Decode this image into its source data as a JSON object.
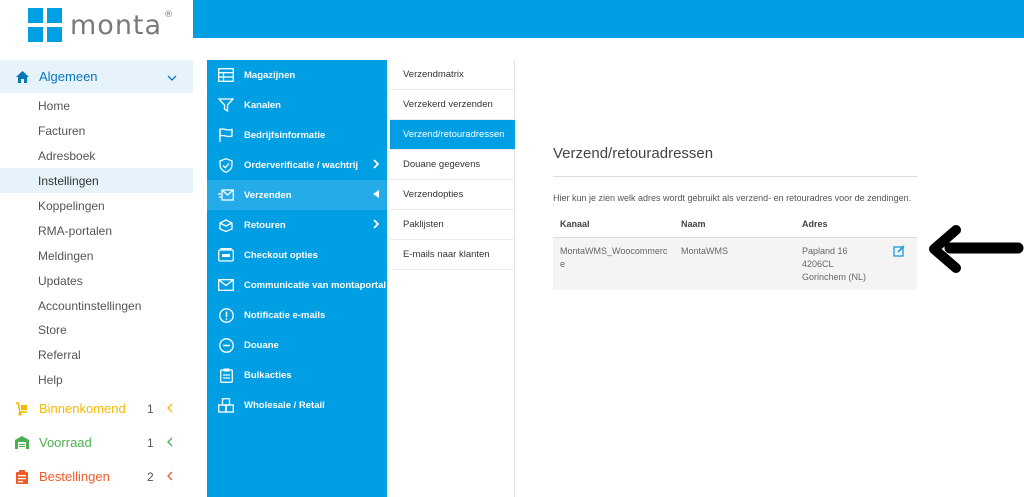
{
  "brand": {
    "logo_text": "monta",
    "registered": "®",
    "color": "#009fe3"
  },
  "sidebar": {
    "section_general": {
      "label": "Algemeen",
      "icon": "home-icon",
      "color": "#0a76b8"
    },
    "items": [
      {
        "label": "Home",
        "active": false
      },
      {
        "label": "Facturen",
        "active": false
      },
      {
        "label": "Adresboek",
        "active": false
      },
      {
        "label": "Instellingen",
        "active": true
      },
      {
        "label": "Koppelingen",
        "active": false
      },
      {
        "label": "RMA-portalen",
        "active": false
      },
      {
        "label": "Meldingen",
        "active": false
      },
      {
        "label": "Updates",
        "active": false
      },
      {
        "label": "Accountinstellingen",
        "active": false
      },
      {
        "label": "Store",
        "active": false
      },
      {
        "label": "Referral",
        "active": false
      },
      {
        "label": "Help",
        "active": false
      }
    ],
    "sections": [
      {
        "label": "Binnenkomend",
        "count": "1",
        "color": "#f5b800",
        "icon": "dolly-icon"
      },
      {
        "label": "Voorraad",
        "count": "1",
        "color": "#4caf50",
        "icon": "warehouse-icon"
      },
      {
        "label": "Bestellingen",
        "count": "2",
        "color": "#f05a28",
        "icon": "clipboard-icon"
      }
    ]
  },
  "menu": {
    "items": [
      {
        "label": "Magazijnen",
        "icon": "table-icon"
      },
      {
        "label": "Kanalen",
        "icon": "funnel-icon"
      },
      {
        "label": "Bedrijfsinformatie",
        "icon": "flag-icon"
      },
      {
        "label": "Orderverificatie / wachtrij",
        "icon": "shield-check-icon",
        "arrow": "right"
      },
      {
        "label": "Verzenden",
        "icon": "envelope-send-icon",
        "arrow": "left",
        "active": true
      },
      {
        "label": "Retouren",
        "icon": "box-return-icon",
        "arrow": "right"
      },
      {
        "label": "Checkout opties",
        "icon": "checkout-icon"
      },
      {
        "label": "Communicatie van montaportal",
        "icon": "mail-icon"
      },
      {
        "label": "Notificatie e-mails",
        "icon": "info-circle-icon"
      },
      {
        "label": "Douane",
        "icon": "minus-circle-icon"
      },
      {
        "label": "Bulkacties",
        "icon": "clipboard-list-icon"
      },
      {
        "label": "Wholesale / Retail",
        "icon": "boxes-icon"
      }
    ]
  },
  "submenu": {
    "items": [
      {
        "label": "Verzendmatrix",
        "active": false
      },
      {
        "label": "Verzekerd verzenden",
        "active": false
      },
      {
        "label": "Verzend/retouradressen",
        "active": true
      },
      {
        "label": "Douane gegevens",
        "active": false
      },
      {
        "label": "Verzendopties",
        "active": false
      },
      {
        "label": "Paklijsten",
        "active": false
      },
      {
        "label": "E-mails naar klanten",
        "active": false
      }
    ]
  },
  "content": {
    "title": "Verzend/retouradressen",
    "description": "Hier kun je zien welk adres wordt gebruikt als verzend- en retouradres voor de zendingen.",
    "columns": [
      "Kanaal",
      "Naam",
      "Adres"
    ],
    "rows": [
      {
        "kanaal_1": "MontaWMS_Woocommerc",
        "kanaal_2": "e",
        "naam": "MontaWMS",
        "adres_1": "Papland 16",
        "adres_2": "4206CL",
        "adres_3": "Gorinchem (NL)"
      }
    ]
  }
}
